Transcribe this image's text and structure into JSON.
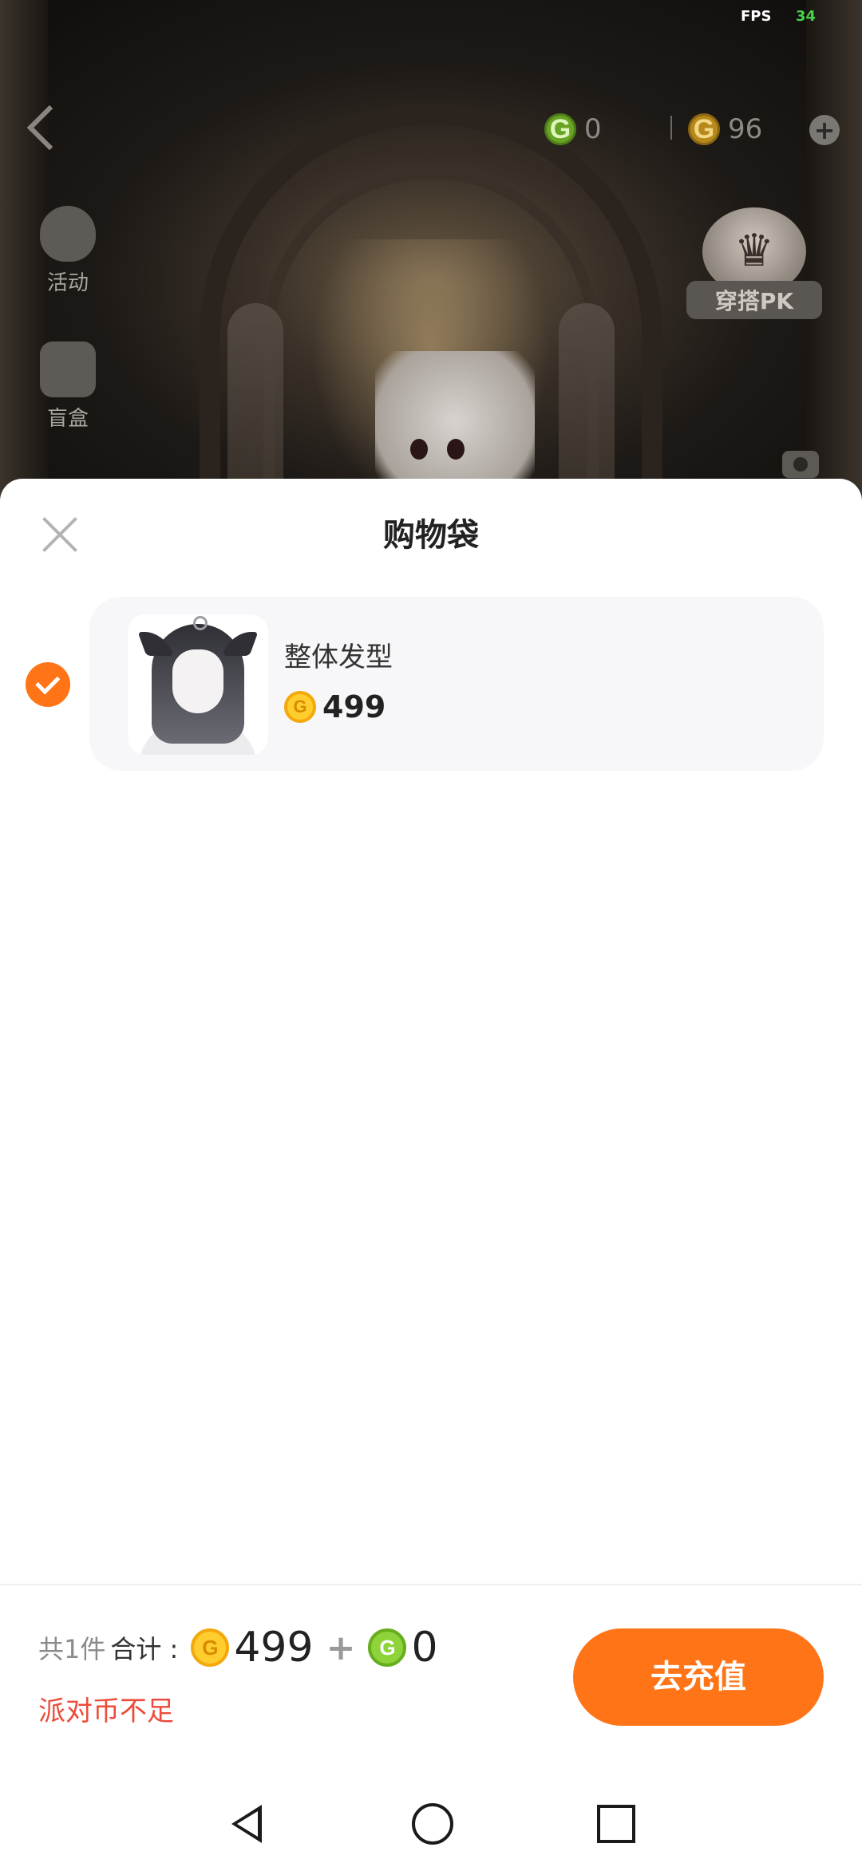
{
  "status_bar": {
    "fps_label": "FPS",
    "fps_value": "34"
  },
  "top_bar": {
    "green_coin_amount": "0",
    "gold_coin_amount": "96",
    "add_symbol": "+"
  },
  "side_menu": {
    "activity_label": "活动",
    "blind_box_label": "盲盒"
  },
  "pk_badge": {
    "label": "穿搭PK"
  },
  "sheet": {
    "title": "购物袋",
    "items": [
      {
        "name": "整体发型",
        "price": "499",
        "selected": true
      }
    ]
  },
  "footer": {
    "count_label": "共1件",
    "total_label": "合计 :",
    "gold_total": "499",
    "plus": "+",
    "green_total": "0",
    "warning": "派对币不足",
    "recharge_button": "去充值"
  },
  "colors": {
    "accent": "#ff7417",
    "warning": "#ec4c3c",
    "gold_coin": "#ffcd2e",
    "green_coin": "#8fd33b",
    "fps_value": "#48d24a"
  },
  "icons": {
    "coin_glyph": "G"
  }
}
